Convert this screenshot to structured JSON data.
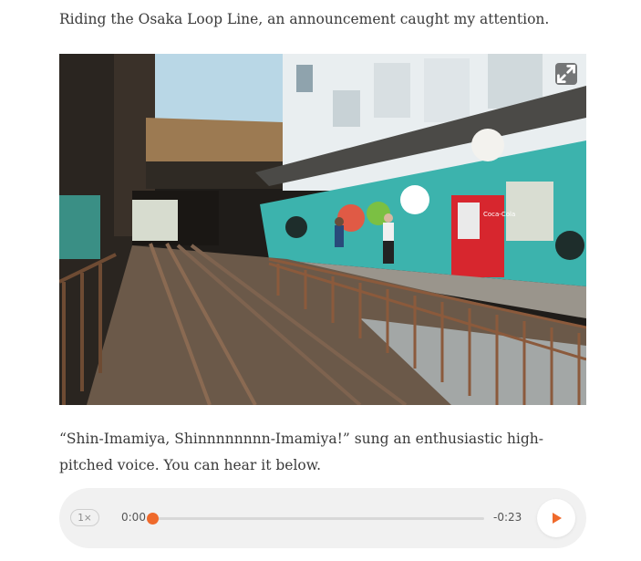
{
  "article": {
    "paragraph_1": "Riding the Osaka Loop Line, an announcement caught my attention.",
    "paragraph_2": "“Shin-Imamiya, Shinnnnnnnn-Imamiya!” sung an enthusiastic high-pitched voice. You can hear it below."
  },
  "photo": {
    "expand_icon": "expand-icon",
    "vending_machine_text": "Coca-Cola"
  },
  "player": {
    "speed_label": "1×",
    "current_time": "0:00",
    "remaining_time": "-0:23",
    "progress": 0.0,
    "accent_color": "#ef6a2c",
    "play_icon": "play-icon"
  }
}
